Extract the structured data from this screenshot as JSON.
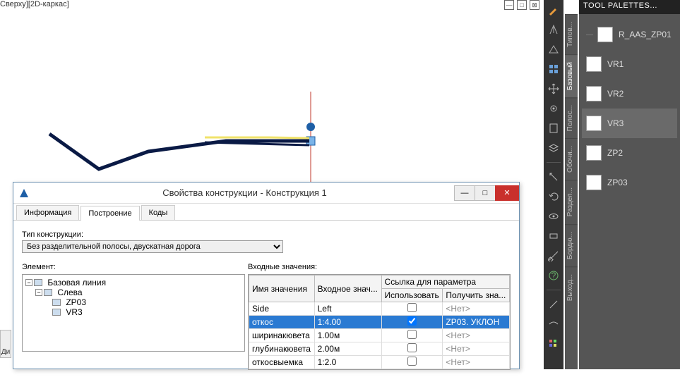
{
  "viewport": {
    "title": "Сверху][2D-каркас]"
  },
  "palettes": {
    "title": "TOOL PALETTES...",
    "items": [
      "R_AAS_ZP01",
      "VR1",
      "VR2",
      "VR3",
      "ZP2",
      "ZP03"
    ],
    "selected": "VR3"
  },
  "vtabs": [
    "Типов...",
    "Базовый",
    "Полос...",
    "Обочи...",
    "Раздел...",
    "Бордю...",
    "Выход..."
  ],
  "vtab_active": "Базовый",
  "dialog": {
    "title": "Свойства конструкции - Конструкция 1",
    "tabs": [
      "Информация",
      "Построение",
      "Коды"
    ],
    "tab_active": "Построение",
    "type_label": "Тип конструкции:",
    "type_value": "Без разделительной полосы, двускатная дорога",
    "element_label": "Элемент:",
    "inputs_label": "Входные значения:",
    "tree": {
      "root": "Базовая линия",
      "side": "Слева",
      "children": [
        "ZP03",
        "VR3"
      ]
    },
    "grid": {
      "h_name": "Имя значения",
      "h_input": "Входное знач...",
      "h_link": "Ссылка для параметра",
      "h_use": "Использовать",
      "h_get": "Получить зна...",
      "none": "<Нет>",
      "rows": [
        {
          "name": "Side",
          "val": "Left",
          "use": false,
          "get": "<Нет>",
          "sel": false
        },
        {
          "name": "откос",
          "val": "1:4.00",
          "use": true,
          "get": "ZP03. УКЛОН",
          "sel": true
        },
        {
          "name": "ширинакювета",
          "val": "1.00м",
          "use": false,
          "get": "<Нет>",
          "sel": false
        },
        {
          "name": "глубинакювета",
          "val": "2.00м",
          "use": false,
          "get": "<Нет>",
          "sel": false
        },
        {
          "name": "откосвыемка",
          "val": "1:2.0",
          "use": false,
          "get": "<Нет>",
          "sel": false
        }
      ]
    }
  },
  "edge": "Ди"
}
